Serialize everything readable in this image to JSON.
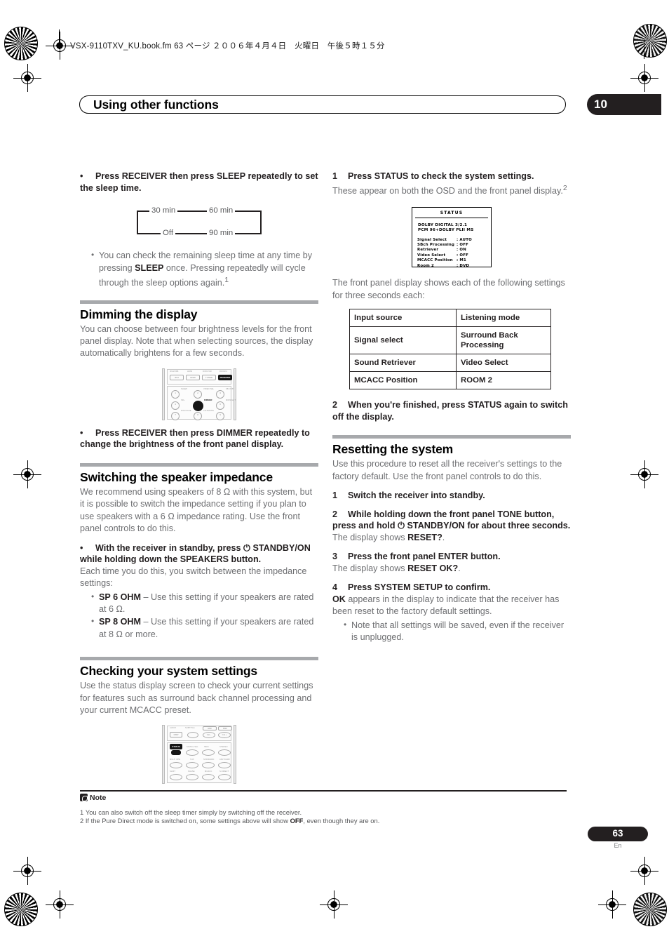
{
  "print_header": {
    "filename_line": "VSX-9110TXV_KU.book.fm 63 ページ ２００６年４月４日　火曜日　午後５時１５分"
  },
  "chapter": {
    "title": "Using other functions",
    "number": "10"
  },
  "colors": {
    "heading": "#000000",
    "body": "#6d6e71",
    "rule": "#a7a9ac",
    "dark": "#231f20"
  },
  "left_column": {
    "sleep_bullet": {
      "dot": "•",
      "text": "Press RECEIVER then press SLEEP repeatedly to set the sleep time."
    },
    "sleep_diagram": {
      "top_left": "30 min",
      "top_right": "60 min",
      "bottom_left": "Off",
      "bottom_right": "90 min"
    },
    "sleep_note": "You can check the remaining sleep time at any time by pressing SLEEP once. Pressing repeatedly will cycle through the sleep options again.",
    "sleep_note_prefix": "You can check the remaining sleep time at any time by pressing ",
    "sleep_note_bold": "SLEEP",
    "sleep_note_suffix": " once. Pressing repeatedly will cycle through the sleep options again.",
    "sleep_note_footnote": "1",
    "dimming": {
      "heading": "Dimming the display",
      "body": "You can choose between four brightness levels for the front panel display. Note that when selecting sources, the display automatically brightens for a few seconds.",
      "bullet_dot": "•",
      "bullet": "Press RECEIVER then press DIMMER repeatedly to change the brightness of the front panel display."
    },
    "impedance": {
      "heading": "Switching the speaker impedance",
      "body_1": "We recommend using speakers of 8 ",
      "ohm": "Ω",
      "body_2": " with this system, but it is possible to switch the impedance setting if you plan to use speakers with a 6 ",
      "body_3": " impedance rating. Use the front panel controls to do this.",
      "bullet_dot": "•",
      "bullet": "With the receiver in standby, press ⏻ STANDBY/ON while holding down the SPEAKERS button.",
      "after_bullet": "Each time you do this, you switch between the impedance settings:",
      "options": [
        {
          "label": "SP 6 OHM",
          "desc": " – Use this setting if your speakers are rated at 6 Ω."
        },
        {
          "label": "SP 8 OHM",
          "desc": " – Use this setting if your speakers are rated at 8 Ω or more."
        }
      ]
    },
    "checking": {
      "heading": "Checking your system settings",
      "body": "Use the status display screen to check your current settings for features such as surround back channel processing and your current MCACC preset."
    }
  },
  "right_column": {
    "step1": {
      "num": "1",
      "title": "Press STATUS to check the system settings.",
      "body": "These appear on both the OSD and the front panel display.",
      "footnote": "2"
    },
    "osd": {
      "title": "STATUS",
      "mode_line_1": "DOLBY DIGITAL 3/2.1",
      "mode_line_2": "PCM 96+DOLBY PLII MS",
      "rows": [
        {
          "key": "Signal  Select",
          "sep": ": ",
          "value": "AUTO"
        },
        {
          "key": "SBch  Processing",
          "sep": ": ",
          "value": "OFF"
        },
        {
          "key": "Retriever",
          "sep": ": ",
          "value": "ON"
        },
        {
          "key": "Video  Select",
          "sep": ": ",
          "value": "OFF"
        },
        {
          "key": "MCACC  Position",
          "sep": ": ",
          "value": "M1"
        },
        {
          "key": "Room 2",
          "sep": ": ",
          "value": "DVD"
        }
      ]
    },
    "front_panel_intro": "The front panel display shows each of the following settings for three seconds each:",
    "settings_table": {
      "rows": [
        [
          "Input source",
          "Listening mode"
        ],
        [
          "Signal select",
          "Surround Back Processing"
        ],
        [
          "Sound Retriever",
          "Video Select"
        ],
        [
          "MCACC Position",
          "ROOM 2"
        ]
      ]
    },
    "step2": {
      "num": "2",
      "title": "When you're finished, press STATUS again to switch off the display."
    },
    "resetting": {
      "heading": "Resetting the system",
      "body": "Use this procedure to reset all the receiver's settings to the factory default. Use the front panel controls to do this.",
      "steps": [
        {
          "num": "1",
          "title": "Switch the receiver into standby.",
          "body": ""
        },
        {
          "num": "2",
          "title": "While holding down the front panel TONE button, press and hold ⏻ STANDBY/ON for about three seconds.",
          "body_prefix": "The display shows ",
          "body_bold": "RESET?",
          "body_suffix": "."
        },
        {
          "num": "3",
          "title": "Press the front panel ENTER button.",
          "body_prefix": "The display shows ",
          "body_bold": "RESET OK?",
          "body_suffix": "."
        },
        {
          "num": "4",
          "title": "Press SYSTEM SETUP to confirm.",
          "body_bold_lead": "OK",
          "body_suffix_lead": " appears in the display to indicate that the receiver has been reset to the factory default settings."
        }
      ],
      "final_note": "Note that all settings will be saved, even if the receiver is unplugged."
    }
  },
  "remote_dimmer": {
    "top_row": [
      {
        "cap": "iPod/USB",
        "label": "iPod"
      },
      {
        "cap": "HDMI",
        "label": "HDMI"
      },
      {
        "cap": "DVR/VCR",
        "label": "TUNER"
      },
      {
        "cap": "ROOM 2",
        "label": "RECEIVER",
        "highlighted": true
      }
    ],
    "keys": [
      {
        "label": "1",
        "cap": "SLEEP"
      },
      {
        "label": "2",
        "cap": "VIDEO SEL"
      },
      {
        "label": "3",
        "cap": "SB ch BT"
      },
      {
        "label": "4",
        "cap": "SR+"
      },
      {
        "label": "5",
        "cap": "DIMMER",
        "highlighted": true
      },
      {
        "label": "6",
        "cap": "MIDNIGHT LOUDNESS"
      },
      {
        "label": "7",
        "cap": "DIALOGUE"
      },
      {
        "label": "8",
        "cap": "LISTENING"
      },
      {
        "label": "9",
        "cap": ""
      }
    ]
  },
  "remote_status": {
    "top_caps": [
      "AUDIO",
      "SUBTITLE",
      "HDD",
      "DISC"
    ],
    "top_labels": [
      "DISP",
      "",
      "CH –",
      "CH +"
    ],
    "keys": [
      {
        "label": "STATUS",
        "highlighted": true
      },
      {
        "label": "SIGNAL SEL"
      },
      {
        "label": "SBch"
      },
      {
        "label": "STEREO"
      },
      {
        "label": "MULTI OPE"
      },
      {
        "label": "THX"
      },
      {
        "label": "STANDARD"
      },
      {
        "label": "ADV SURR"
      },
      {
        "label": "SHIFT"
      },
      {
        "label": "PHASE"
      },
      {
        "label": "MCACC"
      },
      {
        "label": "S.DIRECT"
      }
    ]
  },
  "notes": {
    "heading": "Note",
    "items": [
      {
        "num": "1",
        "text": "You can also switch off the sleep timer simply by switching off the receiver."
      },
      {
        "num": "2",
        "prefix": "If the Pure Direct mode is switched on, some settings above will show ",
        "bold": "OFF",
        "suffix": ", even though they are on."
      }
    ]
  },
  "footer": {
    "page_number": "63",
    "language": "En"
  }
}
